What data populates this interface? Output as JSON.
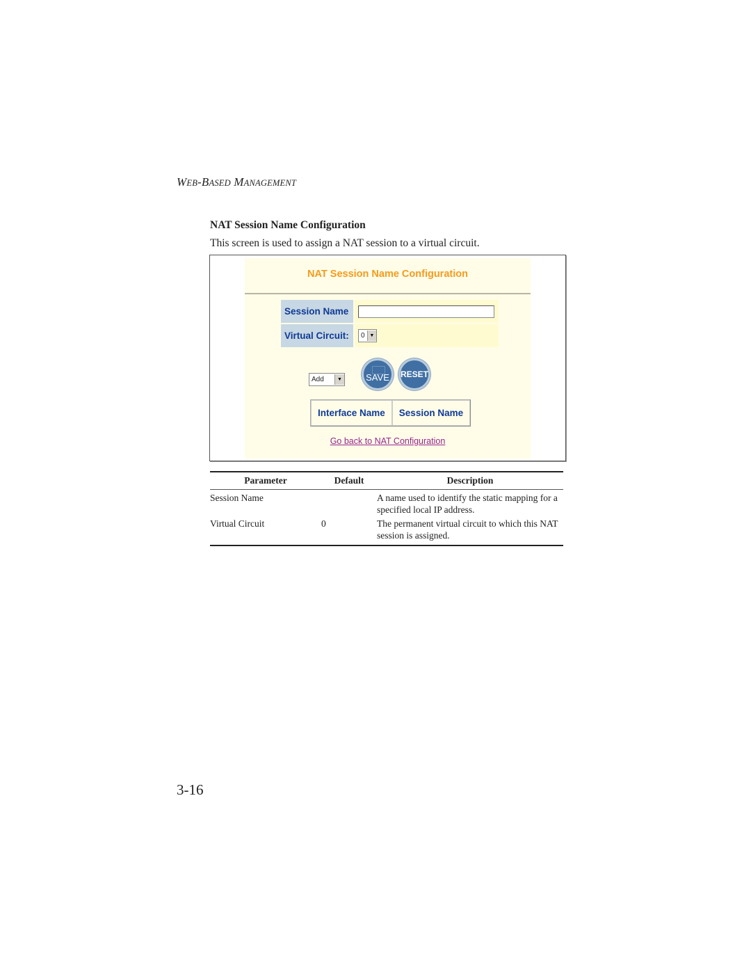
{
  "running_head": {
    "first_w": "W",
    "eb": "EB",
    "dash_b": "-B",
    "ased": "ASED",
    "space_m": " M",
    "anagement": "ANAGEMENT"
  },
  "section_title": "NAT Session Name Configuration",
  "intro": "This screen is used to assign a NAT session to a virtual circuit.",
  "screenshot": {
    "title": "NAT Session Name Configuration",
    "form": {
      "session_name_label": "Session Name",
      "session_name_value": "",
      "virtual_circuit_label": "Virtual Circuit:",
      "virtual_circuit_value": "0"
    },
    "action_select_value": "Add",
    "save_label": "SAVE",
    "reset_label": "RESET",
    "table_headers": [
      "Interface Name",
      "Session Name"
    ],
    "back_link": "Go back to NAT Configuration"
  },
  "param_table": {
    "headers": [
      "Parameter",
      "Default",
      "Description"
    ],
    "rows": [
      {
        "parameter": "Session Name",
        "default": "",
        "description": "A name used to identify the static mapping for a specified local IP address."
      },
      {
        "parameter": "Virtual Circuit",
        "default": "0",
        "description": "The permanent virtual circuit to which this NAT session is assigned."
      }
    ]
  },
  "page_number": "3-16"
}
